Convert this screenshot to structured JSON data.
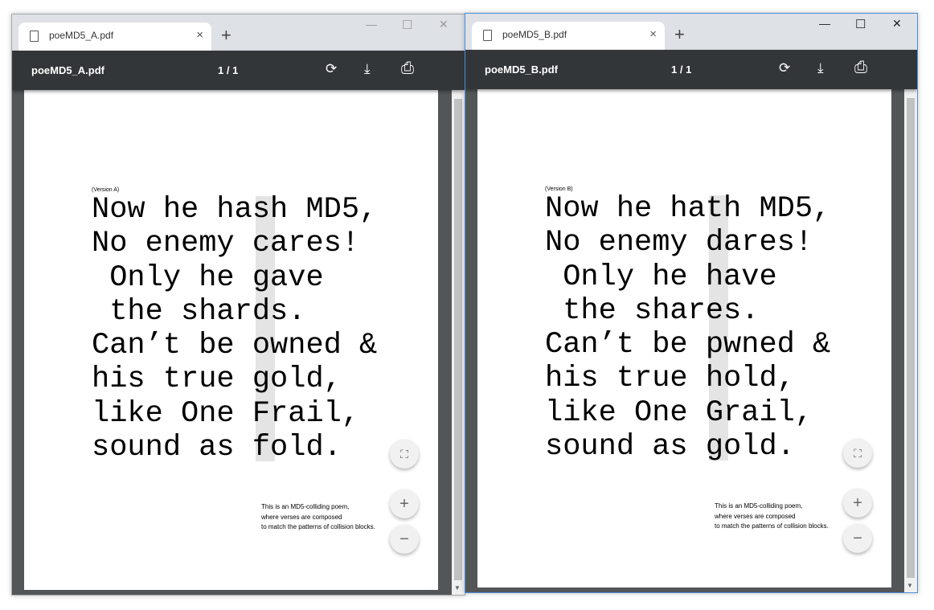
{
  "windows": [
    {
      "tab_title": "poeMD5_A.pdf",
      "toolbar_filename": "poeMD5_A.pdf",
      "page_indicator": "1 / 1",
      "version_label": "(Version A)",
      "poem_lines": [
        "Now he hash MD5,",
        "No enemy cares!",
        " Only he gave",
        " the shards.",
        "Can’t be owned &",
        "his true gold,",
        "like One Frail,",
        "sound as fold."
      ],
      "note_lines": [
        "This is an MD5-colliding poem,",
        "where verses are composed",
        "to match the patterns of collision blocks."
      ],
      "active": false
    },
    {
      "tab_title": "poeMD5_B.pdf",
      "toolbar_filename": "poeMD5_B.pdf",
      "page_indicator": "1 / 1",
      "version_label": "(Version B)",
      "poem_lines": [
        "Now he hath MD5,",
        "No enemy dares!",
        " Only he have",
        " the shares.",
        "Can’t be pwned &",
        "his true hold,",
        "like One Grail,",
        "sound as gold."
      ],
      "note_lines": [
        "This is an MD5-colliding poem,",
        "where verses are composed",
        "to match the patterns of collision blocks."
      ],
      "active": true
    }
  ],
  "icons": {
    "tab_close": "×",
    "new_tab": "+",
    "minimize": "—",
    "maximize": "☐",
    "close": "✕",
    "rotate": "⟳",
    "download": "⤓",
    "print": "⎙",
    "fit": "⛶",
    "zoom_in": "+",
    "zoom_out": "−",
    "scroll_up": "▲",
    "scroll_down": "▼"
  }
}
